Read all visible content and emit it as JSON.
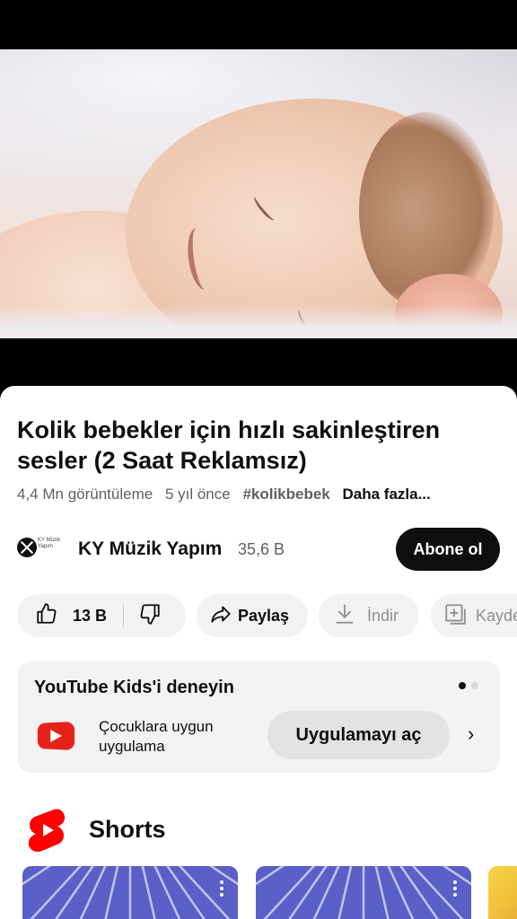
{
  "video": {
    "title": "Kolik bebekler için hızlı sakinleştiren sesler (2 Saat Reklamsız)",
    "views": "4,4 Mn görüntüleme",
    "age": "5 yıl önce",
    "hashtag": "#kolikbebek",
    "more": "Daha fazla..."
  },
  "channel": {
    "avatar_text": "KY Müzik Yapım",
    "name": "KY Müzik Yapım",
    "subscribers": "35,6 B",
    "subscribe_label": "Abone ol"
  },
  "actions": {
    "like_count": "13 B",
    "share_label": "Paylaş",
    "download_label": "İndir",
    "save_label": "Kayde"
  },
  "kids_promo": {
    "title": "YouTube Kids'i deneyin",
    "description": "Çocuklara uygun uygulama",
    "button_label": "Uygulamayı aç",
    "page_indicator": {
      "current": 1,
      "total": 2
    }
  },
  "shorts": {
    "title": "Shorts"
  },
  "icons": {
    "like": "thumb-up-icon",
    "dislike": "thumb-down-icon",
    "share": "share-arrow-icon",
    "download": "download-icon",
    "save": "add-to-playlist-icon",
    "kids": "youtube-kids-logo-icon",
    "shorts": "shorts-logo-icon",
    "chevron": "chevron-right-icon",
    "more": "more-vert-icon"
  },
  "colors": {
    "accent_red": "#ff0000",
    "subscribe_bg": "#0f0f0f",
    "pill_bg": "#f2f2f2",
    "thumb_blue": "#5a60c8"
  }
}
